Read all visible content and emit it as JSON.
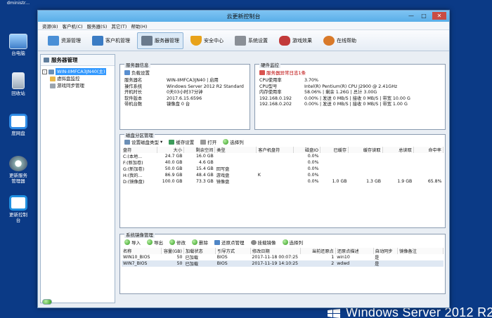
{
  "desktop": {
    "icons": [
      {
        "label": "dministr..."
      },
      {
        "label": "台电脑"
      },
      {
        "label": "回收站"
      },
      {
        "label": "度网盘"
      },
      {
        "label": "更新服务"
      },
      {
        "label": "管理器"
      },
      {
        "label": "更新控制"
      },
      {
        "label": "台"
      }
    ],
    "brand": "Windows Server 2012 R2"
  },
  "window": {
    "title": "云更新控制台",
    "controls": {
      "minimize": "—",
      "maximize": "□",
      "close": "✕"
    }
  },
  "menu": [
    "资源(B)",
    "客户机(C)",
    "服务器(S)",
    "其它(T)",
    "帮助(H)"
  ],
  "toolbar": [
    {
      "label": "资源管理",
      "color": "#4a8fd6"
    },
    {
      "label": "客户机管理",
      "color": "#3b7cc4"
    },
    {
      "label": "服务器管理",
      "color": "#6a7a8c"
    },
    {
      "label": "安全中心",
      "color": "#e8a21a"
    },
    {
      "label": "系统设置",
      "color": "#8a8f96"
    },
    {
      "label": "游戏效果",
      "color": "#c23a3a"
    },
    {
      "label": "在线帮助",
      "color": "#d97a2a"
    }
  ],
  "sidebar": {
    "title": "服务器管理",
    "tree": [
      {
        "label": "WIN-IIMFCA3JN40(主)",
        "expand": "-"
      },
      {
        "label": "虚拟盘监控"
      },
      {
        "label": "游戏同步管理"
      }
    ]
  },
  "server_info": {
    "title": "服务器信息",
    "button": "负载设置",
    "rows": [
      {
        "k": "服务器名",
        "v": "WIN-IIMFCA3JN40 | 启用"
      },
      {
        "k": "操作系统",
        "v": "Windows Server 2012 R2 Standard"
      },
      {
        "k": "开机时长",
        "v": "0天03小时37分钟"
      },
      {
        "k": "软件版本",
        "v": "2017.6.15.6596"
      },
      {
        "k": "带机台数",
        "v": "镜像盘 0 台"
      }
    ]
  },
  "hardware": {
    "title": "硬件监控",
    "button": "服务器异常日志1条",
    "rows": [
      {
        "k": "CPU使用率",
        "v": "3.70%"
      },
      {
        "k": "CPU型号",
        "v": "Intel(R) Pentium(R) CPU  J2900  @ 2.41GHz"
      },
      {
        "k": "内存使用率",
        "v": "58.06% | 剩余 1.26G | 总计 3.00G"
      },
      {
        "k": "192.168.0.192",
        "v": "0.00% | 发送 0 MB/S | 接收 0 MB/S | 带宽 10.00 G"
      },
      {
        "k": "192.168.0.202",
        "v": "0.00% | 发送 0 MB/S | 接收 0 MB/S | 带宽 1.00 G"
      }
    ]
  },
  "disk": {
    "title": "磁盘分区管理",
    "buttons": [
      "设置磁盘类型",
      "缓存设置",
      "打开",
      "选择列"
    ],
    "columns": [
      "盘符",
      "大小",
      "剩余空间",
      "类型",
      "客户机盘符",
      "磁盘IO",
      "已缓存",
      "缓存读取",
      "总读取",
      "命中率"
    ],
    "rows": [
      [
        "C:(本地...",
        "24.7 GB",
        "16.0 GB",
        "",
        "",
        "0.0%",
        "",
        "",
        "",
        ""
      ],
      [
        "F:(新加卷)",
        "40.0 GB",
        "4.6 GB",
        "",
        "",
        "0.0%",
        "",
        "",
        "",
        ""
      ],
      [
        "G:(新加卷)",
        "50.0 GB",
        "15.4 GB",
        "回写盘",
        "",
        "0.0%",
        "",
        "",
        "",
        ""
      ],
      [
        "H:(我的...",
        "86.9 GB",
        "48.4 GB",
        "游戏盘",
        "K",
        "0.0%",
        "",
        "",
        "",
        ""
      ],
      [
        "D:(镜像盘)",
        "100.0 GB",
        "73.3 GB",
        "镜像盘",
        "",
        "0.0%",
        "1.0 GB",
        "1.3 GB",
        "1.9 GB",
        "65.8%"
      ]
    ]
  },
  "mirror": {
    "title": "系统镜像管理",
    "buttons": [
      "导入",
      "导出",
      "修改",
      "删除",
      "还原点管理",
      "挂载镜像",
      "选择列"
    ],
    "columns": [
      "名称",
      "容量(GB)",
      "加载状态",
      "引导方式",
      "修改日期",
      "当前还原点",
      "还原点描述",
      "自动同步",
      "镜像备注"
    ],
    "rows": [
      [
        "WIN10_BIOS",
        "50",
        "已加载",
        "BIOS",
        "2017-11-18 00:07:25",
        "1",
        "win10",
        "是",
        ""
      ],
      [
        "WIN7_BIOS",
        "50",
        "已加载",
        "BIOS",
        "2017-11-19 14:10:25",
        "2",
        "wdwd",
        "是",
        ""
      ]
    ]
  }
}
